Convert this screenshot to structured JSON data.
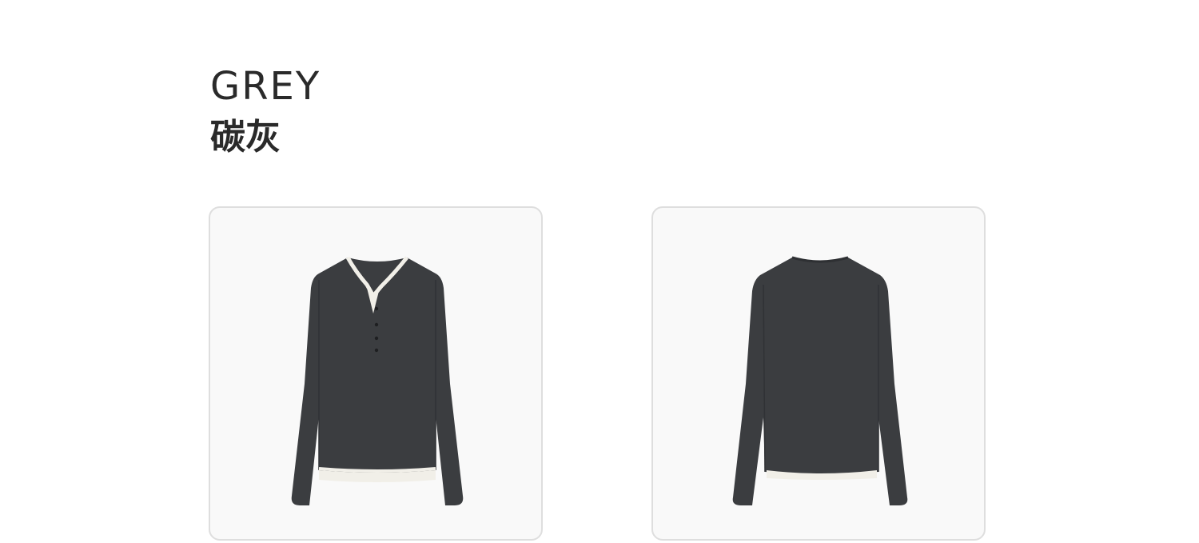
{
  "header": {
    "color_name_en": "GREY",
    "color_name_zh": "碳灰"
  },
  "gallery": {
    "items": [
      {
        "view": "front",
        "icon": "sweater-front-image"
      },
      {
        "view": "back",
        "icon": "sweater-back-image"
      }
    ]
  },
  "colors": {
    "sweater": "#3b3d40",
    "trim": "#f1efe8",
    "card_bg": "#f9f9f9",
    "card_border": "#dedede",
    "text": "#2a2a2a"
  }
}
